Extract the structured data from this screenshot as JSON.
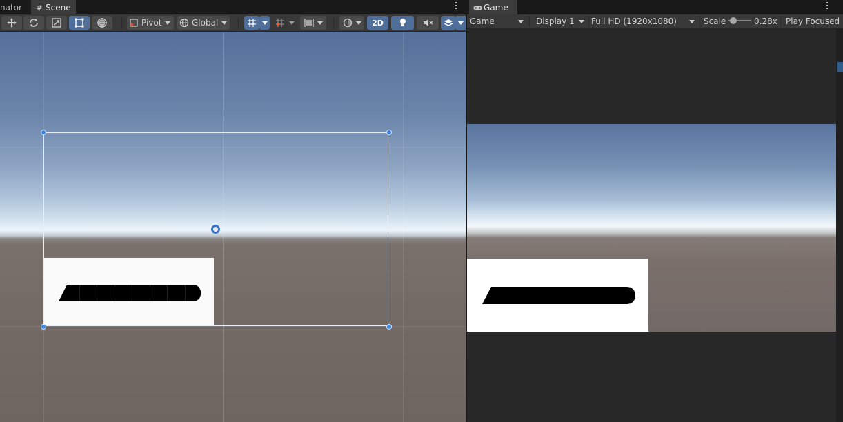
{
  "scene": {
    "tabs": [
      {
        "label": "nator",
        "icon": "animator-icon"
      },
      {
        "label": "Scene",
        "icon": "grid-hash-icon"
      }
    ],
    "toolbar": {
      "tools": [
        "move-tool-icon",
        "rotate-tool-icon",
        "scale-tool-icon",
        "rect-tool-icon",
        "transform-tool-icon"
      ],
      "active_tool": "rect-tool-icon",
      "pivot_label": "Pivot",
      "global_label": "Global",
      "mode_2d_label": "2D",
      "mode_2d_active": true
    },
    "colors": {
      "handle": "#3e86e0",
      "toggle_active": "#4f6e9a"
    }
  },
  "game": {
    "tab_label": "Game",
    "tab_icon": "gamepad-icon",
    "view_dropdown": "Game",
    "display_dropdown": "Display 1",
    "resolution_dropdown": "Full HD (1920x1080)",
    "scale_label": "Scale",
    "scale_value": "0.28x",
    "play_mode_label": "Play Focused"
  }
}
